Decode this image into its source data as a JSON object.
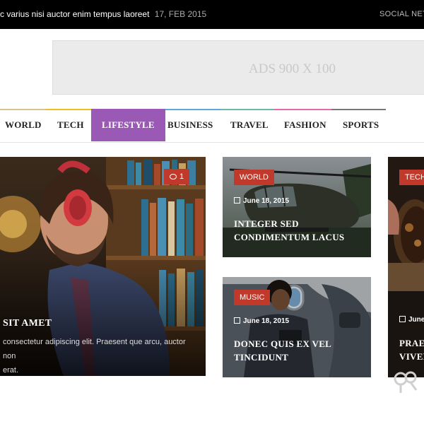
{
  "topbar": {
    "ticker_text": "c varius nisi auctor enim tempus laoreet",
    "ticker_date": "17, FEB 2015",
    "social_label": "SOCIAL NETW"
  },
  "ad": {
    "label": "ADS 900 X 100"
  },
  "nav": {
    "items": [
      {
        "label": "WORLD",
        "line_color": "#d9c28f"
      },
      {
        "label": "TECH",
        "line_color": "#f0c020"
      },
      {
        "label": "LIFESTYLE",
        "line_color": "#9b59b6",
        "active": true
      },
      {
        "label": "BUSINESS",
        "line_color": "#5aaadc"
      },
      {
        "label": "TRAVEL",
        "line_color": "#6fb8a8"
      },
      {
        "label": "FASHION",
        "line_color": "#e26ab0"
      },
      {
        "label": "SPORTS",
        "line_color": "#777777"
      }
    ]
  },
  "featured": {
    "comment_count": "1",
    "title": "SIT AMET",
    "excerpt_line1": "consectetur adipiscing elit. Praesent que arcu, auctor non",
    "excerpt_line2": "erat."
  },
  "cards": [
    {
      "category": "WORLD",
      "date": "June 18, 2015",
      "title_line1": "INTEGER SED",
      "title_line2": "CONDIMENTUM LACUS"
    },
    {
      "category": "MUSIC",
      "date": "June 18, 2015",
      "title_line1": "DONEC QUIS EX VEL",
      "title_line2": "TINCIDUNT"
    },
    {
      "category": "TECH",
      "date": "June",
      "title_line1": "PRAES",
      "title_line2": "VIVER"
    }
  ],
  "colors": {
    "accent": "#9b59b6",
    "badge": "#c0392b",
    "topbar": "#000000"
  }
}
